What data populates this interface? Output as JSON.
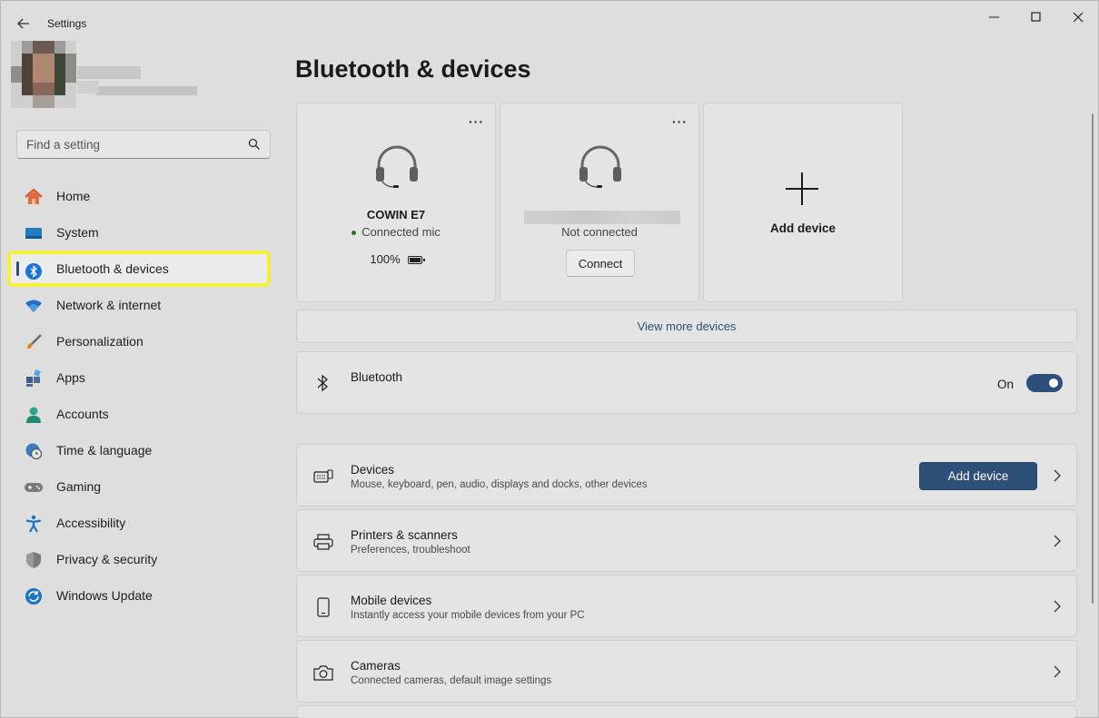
{
  "window": {
    "title": "Settings"
  },
  "search": {
    "placeholder": "Find a setting"
  },
  "sidebar": {
    "items": [
      {
        "label": "Home",
        "icon": "home-icon"
      },
      {
        "label": "System",
        "icon": "monitor-icon"
      },
      {
        "label": "Bluetooth & devices",
        "icon": "bluetooth-icon",
        "active": true
      },
      {
        "label": "Network & internet",
        "icon": "wifi-icon"
      },
      {
        "label": "Personalization",
        "icon": "brush-icon"
      },
      {
        "label": "Apps",
        "icon": "apps-icon"
      },
      {
        "label": "Accounts",
        "icon": "account-icon"
      },
      {
        "label": "Time & language",
        "icon": "globe-clock-icon"
      },
      {
        "label": "Gaming",
        "icon": "gamepad-icon"
      },
      {
        "label": "Accessibility",
        "icon": "accessibility-icon"
      },
      {
        "label": "Privacy & security",
        "icon": "shield-icon"
      },
      {
        "label": "Windows Update",
        "icon": "update-icon"
      }
    ]
  },
  "main": {
    "title": "Bluetooth & devices",
    "devices": [
      {
        "name": "COWIN E7",
        "status": "Connected mic",
        "battery": "100%"
      },
      {
        "name": "",
        "status": "Not connected",
        "action": "Connect"
      }
    ],
    "add_device_card": "Add device",
    "more_label": "···",
    "view_more": "View more devices",
    "bluetooth": {
      "label": "Bluetooth",
      "state": "On"
    },
    "rows": [
      {
        "title": "Devices",
        "desc": "Mouse, keyboard, pen, audio, displays and docks, other devices",
        "button": "Add device",
        "icon": "keyboard-device-icon"
      },
      {
        "title": "Printers & scanners",
        "desc": "Preferences, troubleshoot",
        "icon": "printer-icon"
      },
      {
        "title": "Mobile devices",
        "desc": "Instantly access your mobile devices from your PC",
        "icon": "phone-icon"
      },
      {
        "title": "Cameras",
        "desc": "Connected cameras, default image settings",
        "icon": "camera-icon"
      }
    ]
  },
  "colors": {
    "accent": "#2b4f79",
    "highlight_outline": "#f5ee3a"
  }
}
